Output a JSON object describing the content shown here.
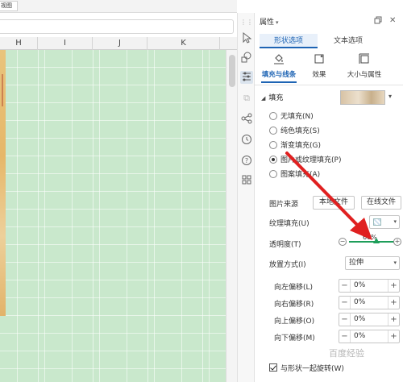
{
  "topbar": {
    "label": "视图"
  },
  "sheet": {
    "columns": [
      "H",
      "I",
      "J",
      "K"
    ]
  },
  "panel": {
    "title": "属性",
    "tabs": [
      {
        "label": "形状选项",
        "active": true
      },
      {
        "label": "文本选项",
        "active": false
      }
    ],
    "subtabs": [
      {
        "label": "填充与线条",
        "icon": "fill-bucket-icon",
        "active": true
      },
      {
        "label": "效果",
        "icon": "effects-icon",
        "active": false
      },
      {
        "label": "大小与属性",
        "icon": "size-icon",
        "active": false
      }
    ],
    "fill_section": "填充",
    "fill_options": [
      {
        "label": "无填充(N)",
        "checked": false
      },
      {
        "label": "纯色填充(S)",
        "checked": false
      },
      {
        "label": "渐变填充(G)",
        "checked": false
      },
      {
        "label": "图片或纹理填充(P)",
        "checked": true
      },
      {
        "label": "图案填充(A)",
        "checked": false
      }
    ],
    "picture_source": {
      "label": "图片来源",
      "local_button": "本地文件",
      "online_button": "在线文件"
    },
    "texture": {
      "label": "纹理填充(U)"
    },
    "transparency": {
      "label": "透明度(T)",
      "value": "60%",
      "level": 0.6
    },
    "placement": {
      "label": "放置方式(I)",
      "value": "拉伸"
    },
    "offsets": [
      {
        "label": "向左偏移(L)",
        "value": "0%"
      },
      {
        "label": "向右偏移(R)",
        "value": "0%"
      },
      {
        "label": "向上偏移(O)",
        "value": "0%"
      },
      {
        "label": "向下偏移(M)",
        "value": "0%"
      }
    ],
    "rotate_with_shape": {
      "label": "与形状一起旋转(W)",
      "checked": true
    }
  },
  "watermark": "百度经验",
  "accent_color": "#1e64b4",
  "slider_color": "#1e9e5a",
  "arrow_color": "#e02020"
}
